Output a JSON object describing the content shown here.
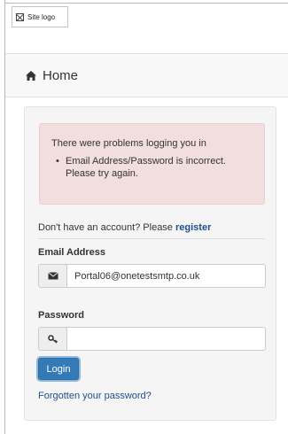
{
  "logo": {
    "alt_text": "Site logo"
  },
  "navbar": {
    "home_label": "Home",
    "home_icon": "home-icon"
  },
  "alert": {
    "title": "There were problems logging you in",
    "items": [
      "Email Address/Password is incorrect.",
      "Please try again."
    ],
    "background_color": "#f2dede"
  },
  "register": {
    "prompt": "Don't have an account? Please",
    "link_label": "register"
  },
  "email": {
    "label": "Email Address",
    "value": "Portal06@onetestsmtp.co.uk",
    "icon": "envelope-icon"
  },
  "password": {
    "label": "Password",
    "value": "",
    "icon": "key-icon"
  },
  "login_button": {
    "label": "Login",
    "color": "#337ab7"
  },
  "forgot_link": {
    "label": "Forgotten your password?"
  }
}
